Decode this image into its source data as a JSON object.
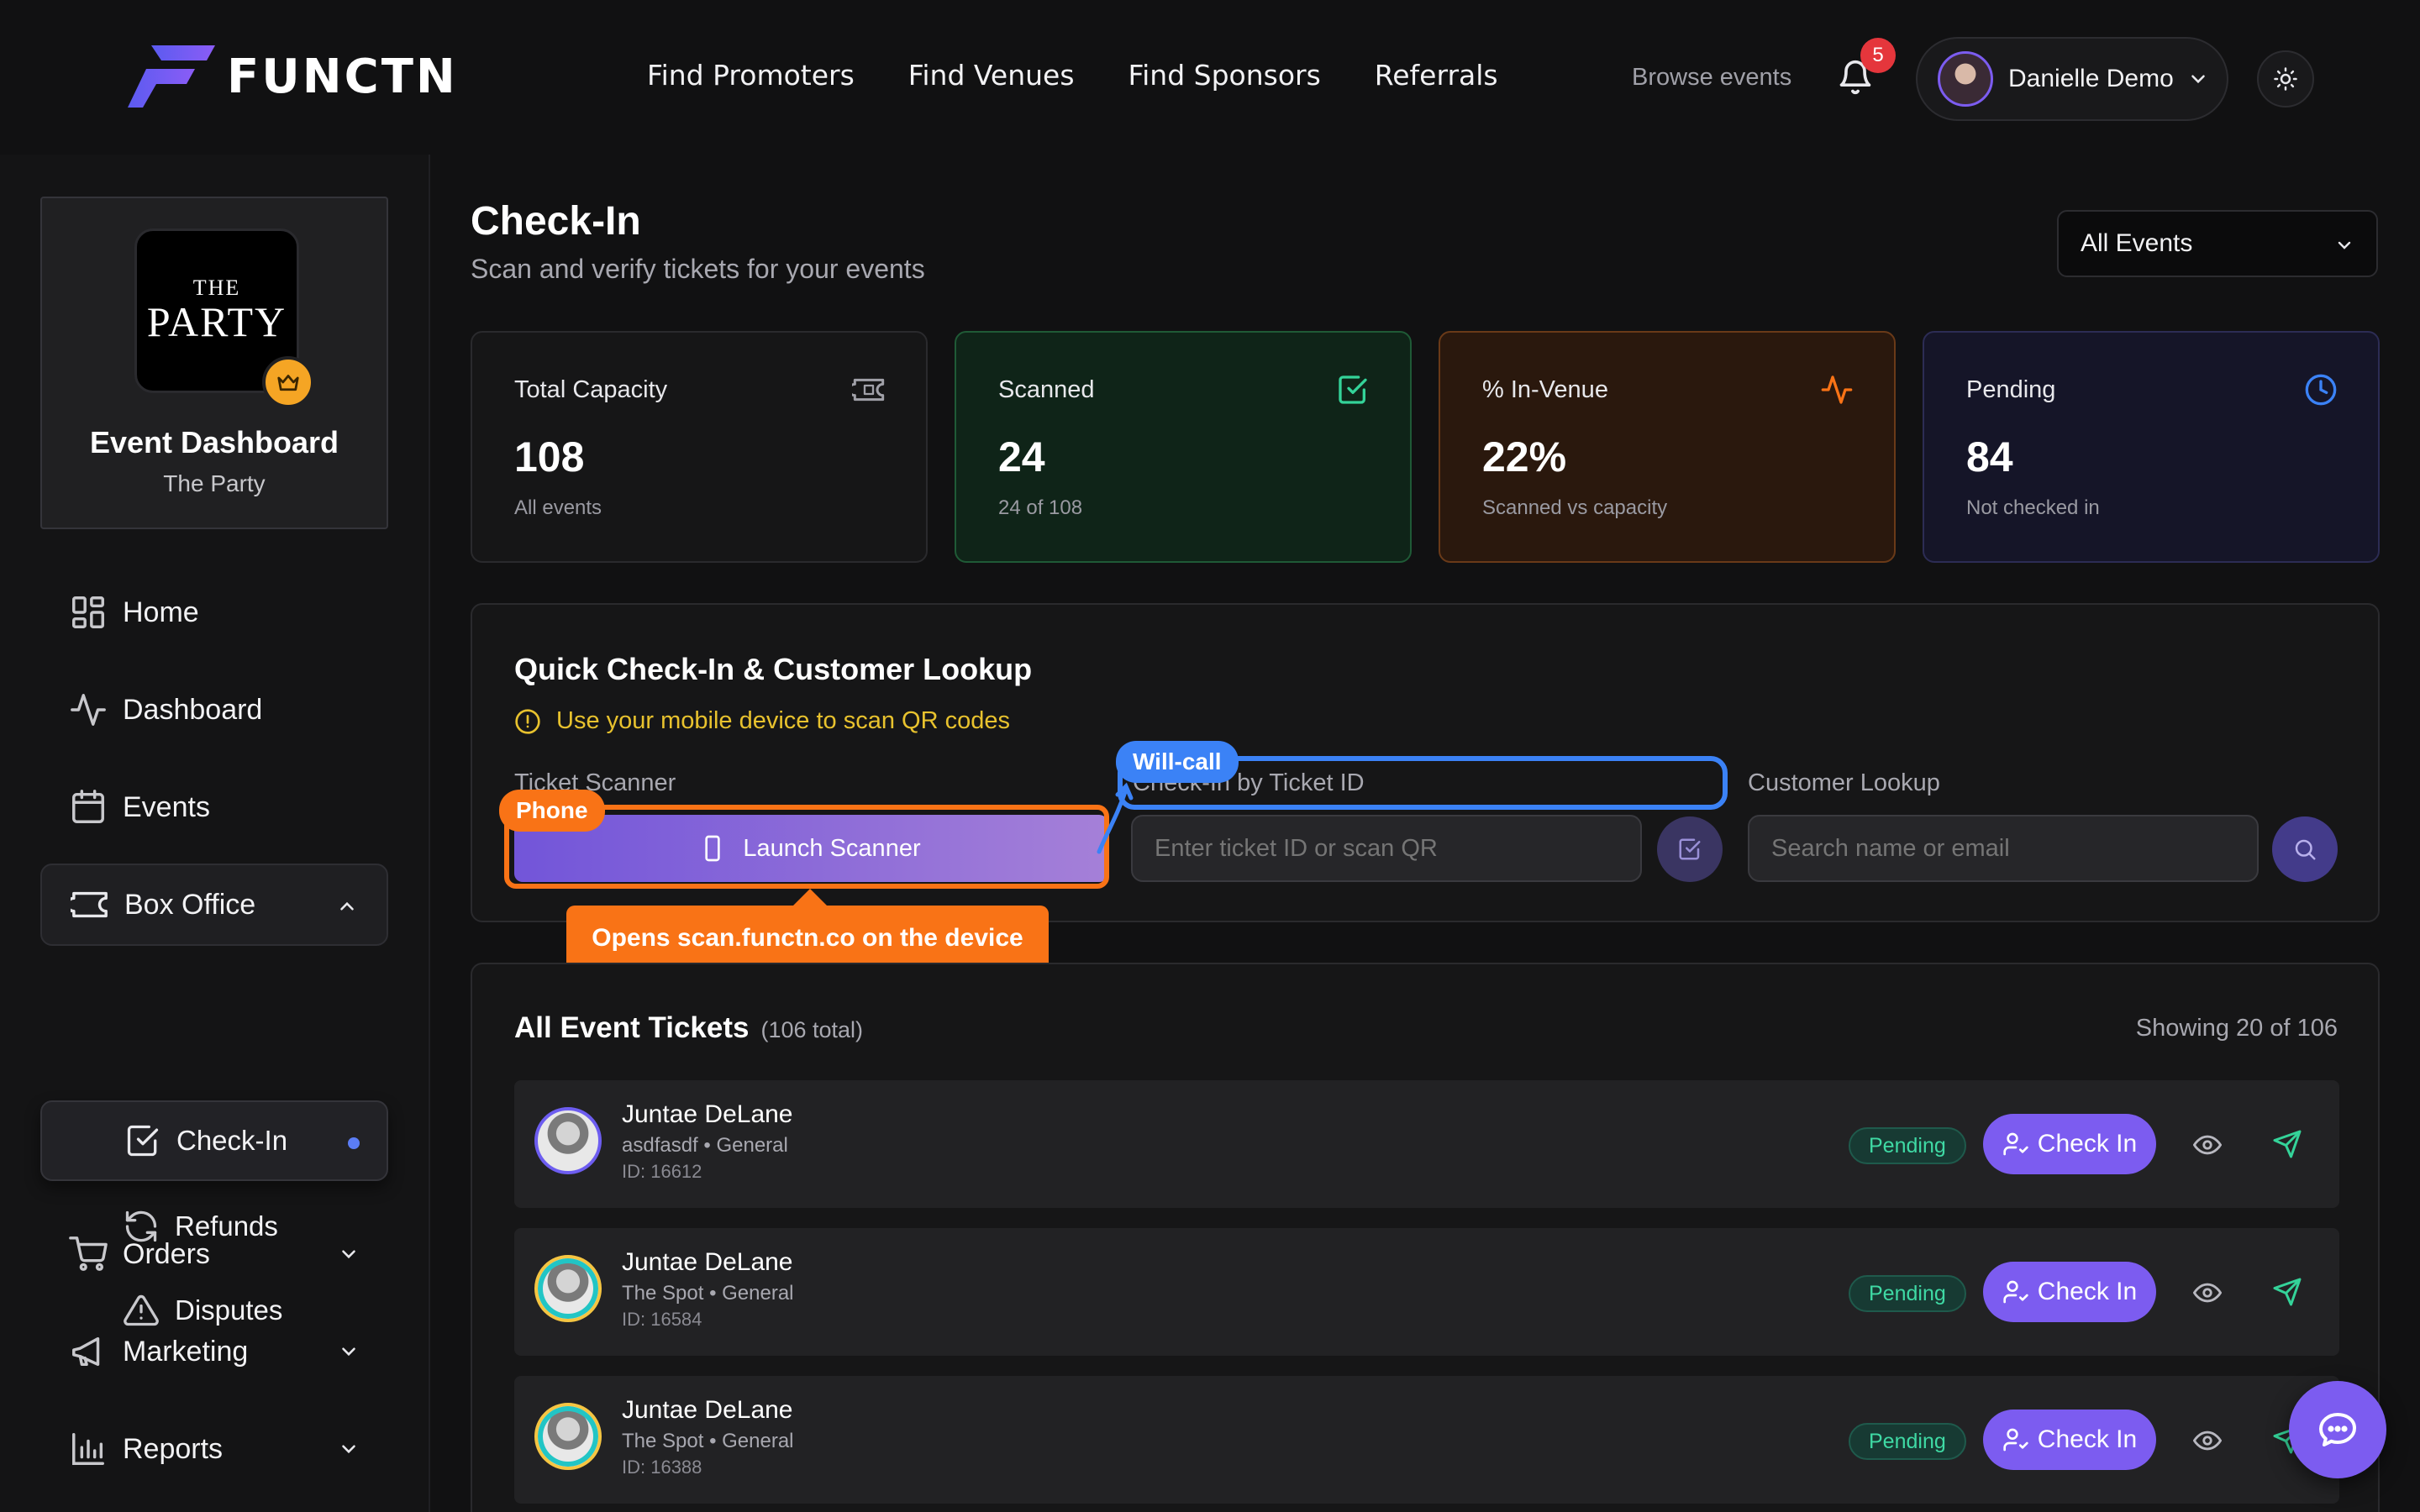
{
  "brand": {
    "name": "FUNCTN"
  },
  "nav": {
    "links": [
      "Find Promoters",
      "Find Venues",
      "Find Sponsors",
      "Referrals"
    ],
    "browse": "Browse events",
    "notification_count": "5",
    "user_name": "Danielle Demo"
  },
  "sidebar": {
    "event_logo_small": "THE",
    "event_logo_large": "PARTY",
    "event_title": "Event Dashboard",
    "event_name": "The Party",
    "items": [
      {
        "label": "Home",
        "icon": "grid-icon"
      },
      {
        "label": "Dashboard",
        "icon": "activity-icon"
      },
      {
        "label": "Events",
        "icon": "calendar-icon"
      },
      {
        "label": "Box Office",
        "icon": "ticket-icon"
      },
      {
        "label": "Orders",
        "icon": "cart-icon"
      },
      {
        "label": "Marketing",
        "icon": "megaphone-icon"
      },
      {
        "label": "Reports",
        "icon": "bar-chart-icon"
      }
    ],
    "sub_items": [
      {
        "label": "Check-In",
        "icon": "check-square-icon"
      },
      {
        "label": "Refunds",
        "icon": "refresh-icon"
      },
      {
        "label": "Disputes",
        "icon": "alert-triangle-icon"
      }
    ]
  },
  "page": {
    "title": "Check-In",
    "subtitle": "Scan and verify tickets for your events",
    "event_filter": "All Events"
  },
  "stats": [
    {
      "label": "Total Capacity",
      "value": "108",
      "note": "All events",
      "icon": "ticket-icon",
      "color": "#a0a0a8"
    },
    {
      "label": "Scanned",
      "value": "24",
      "note": "24 of 108",
      "icon": "check-square-icon",
      "color": "#34d399"
    },
    {
      "label": "% In-Venue",
      "value": "22%",
      "note": "Scanned vs capacity",
      "icon": "activity-icon",
      "color": "#f97316"
    },
    {
      "label": "Pending",
      "value": "84",
      "note": "Not checked in",
      "icon": "clock-icon",
      "color": "#3b82f6"
    }
  ],
  "quick": {
    "title": "Quick Check-In & Customer Lookup",
    "hint": "Use your mobile device to scan QR codes",
    "scanner_label": "Ticket Scanner",
    "scanner_button": "Launch Scanner",
    "ticket_label": "Check-In by Ticket ID",
    "ticket_placeholder": "Enter ticket ID or scan QR",
    "lookup_label": "Customer Lookup",
    "lookup_placeholder": "Search name or email"
  },
  "annotations": {
    "phone_tag": "Phone",
    "phone_callout": "Opens scan.functn.co on the device",
    "willcall_tag": "Will-call"
  },
  "tickets": {
    "title": "All Event Tickets",
    "total": "(106 total)",
    "showing": "Showing 20 of 106",
    "rows": [
      {
        "name": "Juntae DeLane",
        "meta": "asdfasdf • General",
        "id": "ID: 16612",
        "status": "Pending",
        "action": "Check In"
      },
      {
        "name": "Juntae DeLane",
        "meta": "The Spot • General",
        "id": "ID: 16584",
        "status": "Pending",
        "action": "Check In"
      },
      {
        "name": "Juntae DeLane",
        "meta": "The Spot • General",
        "id": "ID: 16388",
        "status": "Pending",
        "action": "Check In"
      }
    ]
  },
  "colors": {
    "accent": "#7c5cf0",
    "annotation_orange": "#f97316",
    "annotation_blue": "#3b82f6",
    "pending_green": "#3fd9a4"
  }
}
